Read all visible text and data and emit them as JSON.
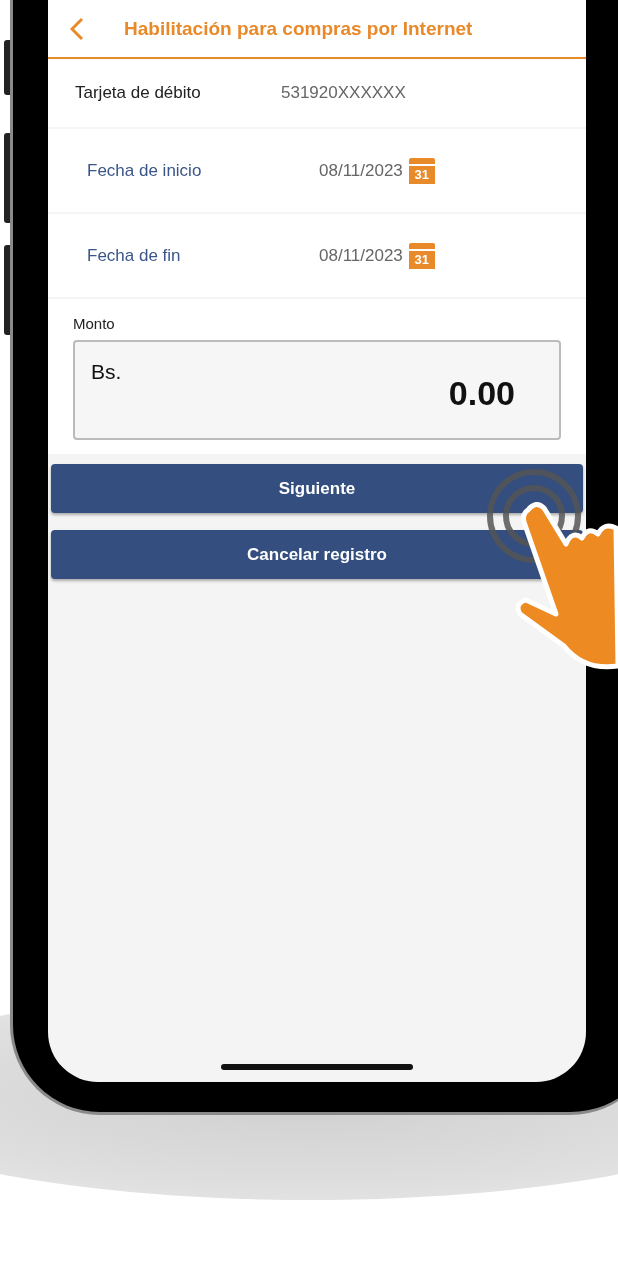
{
  "header": {
    "title": "Habilitación para compras por Internet"
  },
  "rows": [
    {
      "kind": "text",
      "label": "Tarjeta de débito",
      "value": "531920XXXXXX"
    },
    {
      "kind": "date",
      "label": "Fecha de inicio",
      "value": "08/11/2023",
      "calendar_label": "31"
    },
    {
      "kind": "date",
      "label": "Fecha de fin",
      "value": "08/11/2023",
      "calendar_label": "31"
    }
  ],
  "amount": {
    "label": "Monto",
    "currency": "Bs.",
    "value": "0.00"
  },
  "buttons": [
    "Siguiente",
    "Cancelar registro"
  ]
}
